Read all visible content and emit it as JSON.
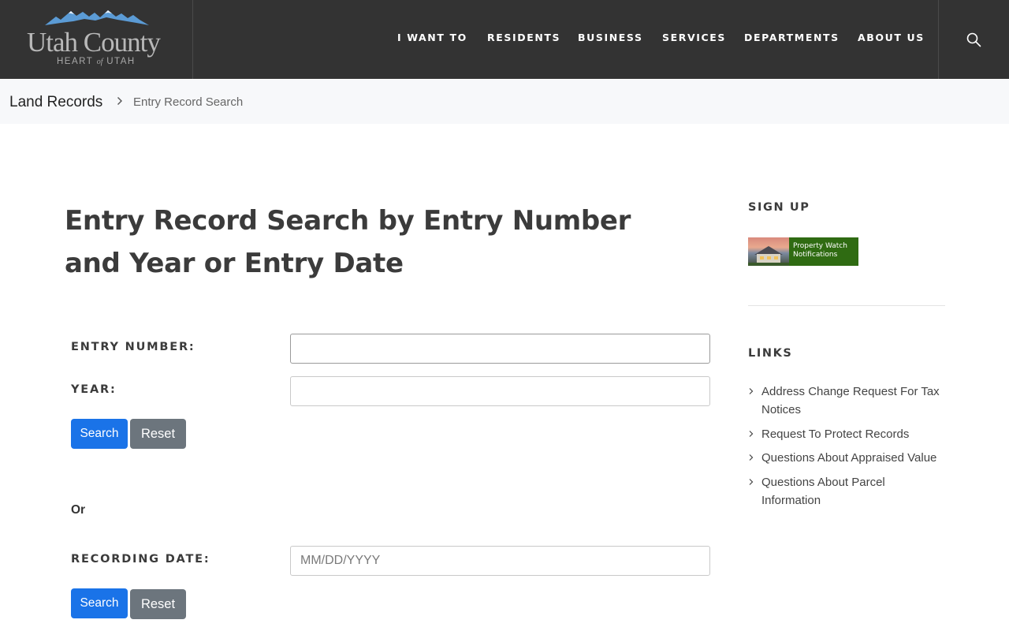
{
  "header": {
    "logo": {
      "name": "Utah County",
      "tagline_pre": "HEART ",
      "tagline_of": "of",
      "tagline_post": " UTAH"
    },
    "nav": [
      {
        "label": "I WANT TO"
      },
      {
        "label": "RESIDENTS"
      },
      {
        "label": "BUSINESS"
      },
      {
        "label": "SERVICES"
      },
      {
        "label": "DEPARTMENTS"
      },
      {
        "label": "ABOUT US"
      }
    ],
    "search_icon": "search-icon"
  },
  "breadcrumb": {
    "root": "Land Records",
    "separator_icon": "chevron-right-icon",
    "current": "Entry Record Search"
  },
  "main": {
    "title": "Entry Record Search by Entry Number and Year or Entry Date",
    "entry_number": {
      "label": "ENTRY NUMBER:",
      "value": ""
    },
    "year": {
      "label": "YEAR:",
      "value": ""
    },
    "search_label": "Search",
    "reset_label": "Reset",
    "or_text": "Or",
    "recording_date": {
      "label": "RECORDING DATE:",
      "placeholder": "MM/DD/YYYY",
      "value": ""
    }
  },
  "sidebar": {
    "signup_heading": "SIGN UP",
    "signup_banner": {
      "line1": "Property Watch",
      "line2": "Notifications",
      "color": "#2f6b12"
    },
    "links_heading": "LINKS",
    "links": [
      "Address Change Request For Tax Notices",
      "Request To Protect Records",
      "Questions About Appraised Value",
      "Questions About Parcel Information"
    ]
  },
  "colors": {
    "header_bg": "#333333",
    "primary": "#1a73e8",
    "secondary": "#6c757d",
    "logo_mountains": "#5b9bd5"
  }
}
